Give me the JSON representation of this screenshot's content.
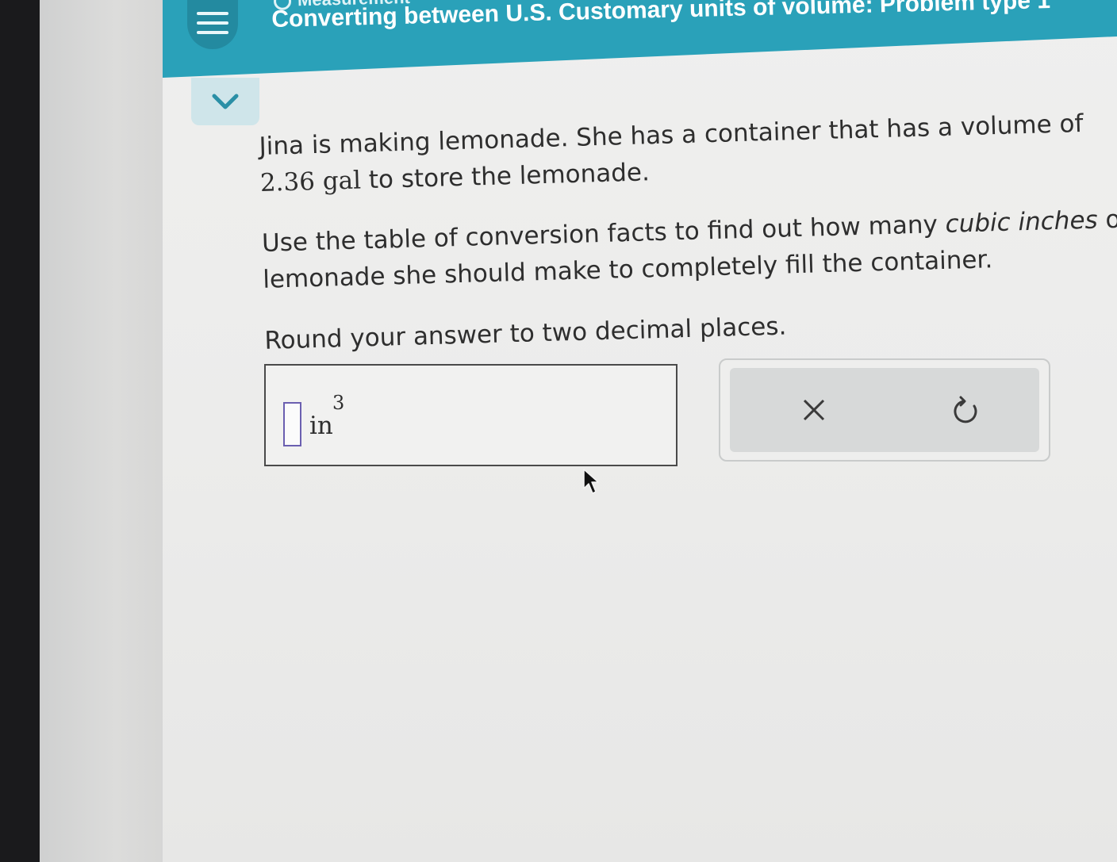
{
  "header": {
    "subtopic": "Measurement",
    "title": "Converting between U.S. Customary units of volume: Problem type 1"
  },
  "question": {
    "line1": "Jina is making lemonade. She has a container that has a volume of",
    "value": "2.36",
    "value_unit": "gal",
    "line2_rest": " to store the lemonade.",
    "instr1_pre": "Use the table of conversion facts to find out how many ",
    "instr1_em": "cubic inches",
    "instr1_post": " of",
    "instr2": "lemonade she should make to completely fill the container.",
    "round": "Round your answer to two decimal places."
  },
  "answer": {
    "value": "",
    "unit": "in",
    "unit_exponent": "3"
  },
  "actions": {
    "clear_icon": "close-icon",
    "undo_icon": "undo-icon"
  },
  "colors": {
    "header": "#2aa1b9",
    "input_border": "#6b5fb0"
  }
}
